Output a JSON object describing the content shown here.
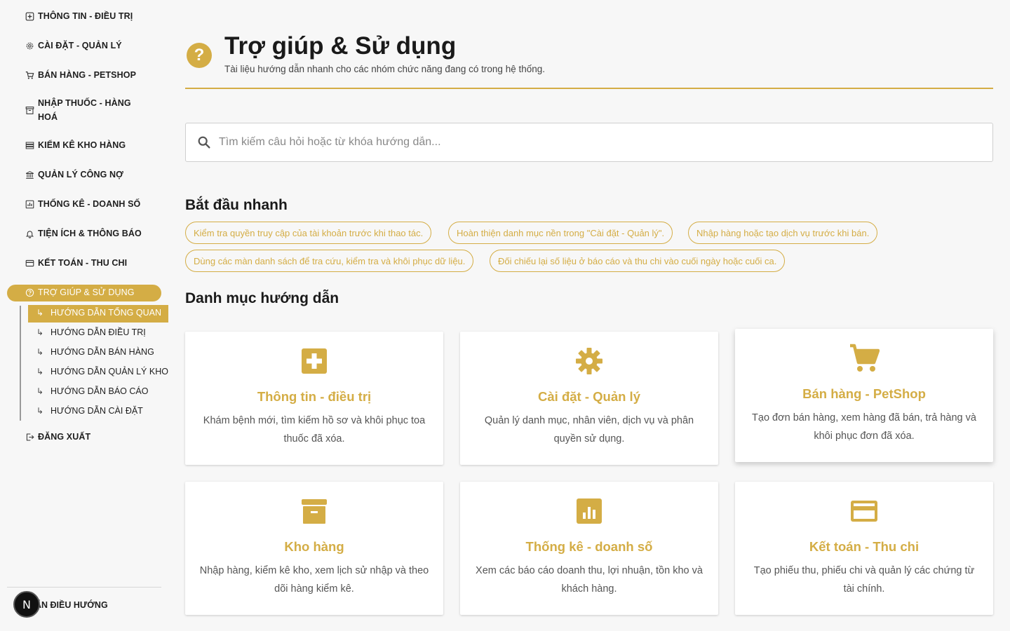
{
  "colors": {
    "accent": "#d4ad45",
    "text": "#1e1e1e",
    "background": "#f7f7f7"
  },
  "sidebar": {
    "items": [
      {
        "label": "THÔNG TIN - ĐIỀU TRỊ",
        "icon": "medical-icon"
      },
      {
        "label": "CÀI ĐẶT - QUẢN LÝ",
        "icon": "gear-icon"
      },
      {
        "label": "BÁN HÀNG - PETSHOP",
        "icon": "cart-icon"
      },
      {
        "label": "NHẬP THUỐC - HÀNG HOÁ",
        "icon": "archive-icon"
      },
      {
        "label": "KIỂM KÊ KHO HÀNG",
        "icon": "list-icon"
      },
      {
        "label": "QUẢN LÝ CÔNG NỢ",
        "icon": "bank-icon"
      },
      {
        "label": "THỐNG KÊ - DOANH SỐ",
        "icon": "chart-icon"
      },
      {
        "label": "TIỆN ÍCH & THÔNG BÁO",
        "icon": "bell-icon"
      },
      {
        "label": "KẾT TOÁN - THU CHI",
        "icon": "credit-card-icon"
      },
      {
        "label": "TRỢ GIÚP & SỬ DỤNG",
        "icon": "help-icon"
      }
    ],
    "sub_items": [
      {
        "label": "HƯỚNG DẪN TỔNG QUAN"
      },
      {
        "label": "HƯỚNG DẪN ĐIỀU TRỊ"
      },
      {
        "label": "HƯỚNG DẪN BÁN HÀNG"
      },
      {
        "label": "HƯỚNG DẪN QUẢN LÝ KHO"
      },
      {
        "label": "HƯỚNG DẪN BÁO CÁO"
      },
      {
        "label": "HƯỚNG DẪN CÀI ĐẶT"
      }
    ],
    "logout_label": "ĐĂNG XUẤT",
    "footer_label": "ẨN ĐIỀU HƯỚNG",
    "badge_letter": "N"
  },
  "header": {
    "title": "Trợ giúp & Sử dụng",
    "subtitle": "Tài liệu hướng dẫn nhanh cho các nhóm chức năng đang có trong hệ thống."
  },
  "search": {
    "placeholder": "Tìm kiếm câu hỏi hoặc từ khóa hướng dẫn..."
  },
  "quick_start": {
    "title": "Bắt đầu nhanh",
    "chips": [
      "Kiểm tra quyền truy cập của tài khoản trước khi thao tác.",
      "Hoàn thiện danh mục nền trong \"Cài đặt - Quản lý\".",
      "Nhập hàng hoặc tạo dịch vụ trước khi bán.",
      "Dùng các màn danh sách để tra cứu, kiểm tra và khôi phục dữ liệu.",
      "Đối chiếu lại số liệu ở báo cáo và thu chi vào cuối ngày hoặc cuối ca."
    ]
  },
  "guides": {
    "title": "Danh mục hướng dẫn",
    "cards": [
      {
        "title": "Thông tin - điều trị",
        "desc": "Khám bệnh mới, tìm kiếm hồ sơ và khôi phục toa thuốc đã xóa.",
        "icon": "medical-cross-icon"
      },
      {
        "title": "Cài đặt - Quản lý",
        "desc": "Quản lý danh mục, nhân viên, dịch vụ và phân quyền sử dụng.",
        "icon": "gear-icon"
      },
      {
        "title": "Bán hàng - PetShop",
        "desc": "Tạo đơn bán hàng, xem hàng đã bán, trả hàng và khôi phục đơn đã xóa.",
        "icon": "cart-icon"
      },
      {
        "title": "Kho hàng",
        "desc": "Nhập hàng, kiểm kê kho, xem lịch sử nhập và theo dõi hàng kiểm kê.",
        "icon": "archive-icon"
      },
      {
        "title": "Thống kê - doanh số",
        "desc": "Xem các báo cáo doanh thu, lợi nhuận, tồn kho và khách hàng.",
        "icon": "chart-icon"
      },
      {
        "title": "Kết toán - Thu chi",
        "desc": "Tạo phiếu thu, phiếu chi và quản lý các chứng từ tài chính.",
        "icon": "credit-card-icon"
      }
    ]
  }
}
